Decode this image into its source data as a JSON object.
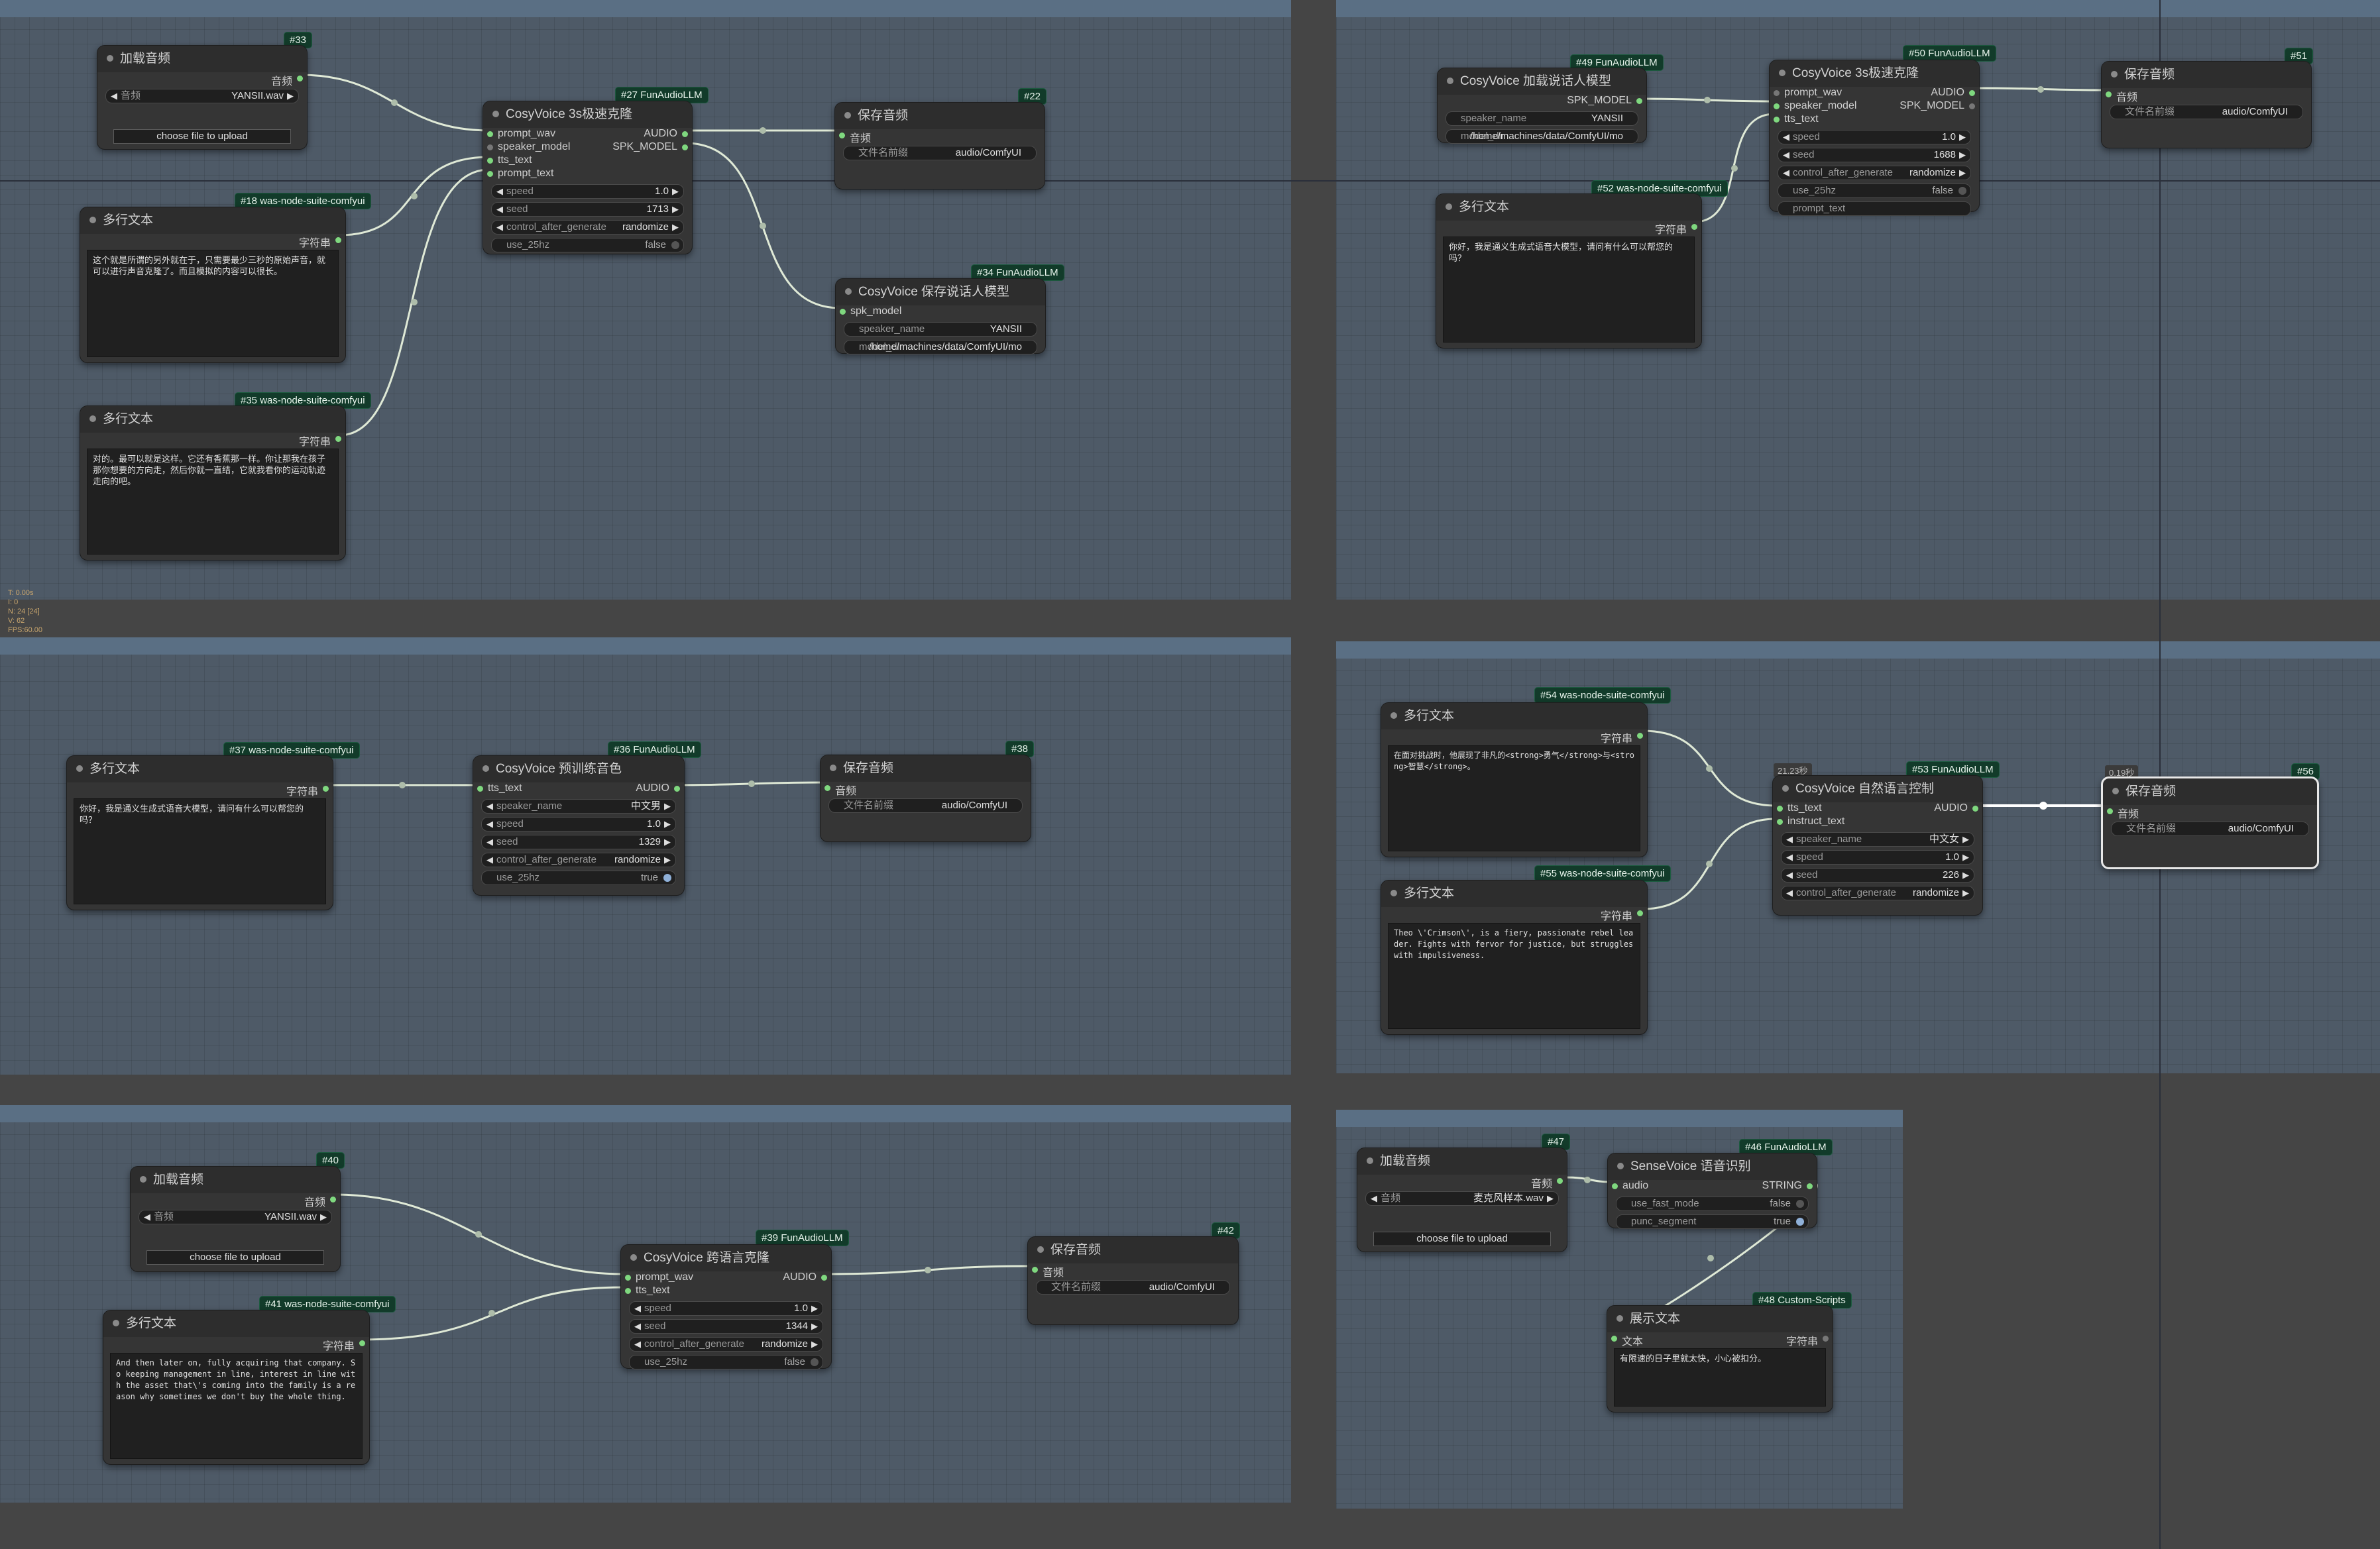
{
  "groups": [
    {
      "id": "g1",
      "title": ""
    },
    {
      "id": "g2",
      "title": ""
    },
    {
      "id": "g3",
      "title": ""
    },
    {
      "id": "g4",
      "title": ""
    },
    {
      "id": "g5",
      "title": ""
    },
    {
      "id": "g6",
      "title": ""
    }
  ],
  "nodes": {
    "n33": {
      "badge": "#33",
      "title": "加载音频",
      "out": "音频",
      "sel_label": "音频",
      "sel_value": "YANSII.wav",
      "upload": "choose file to upload"
    },
    "n18": {
      "badge": "#18 was-node-suite-comfyui",
      "title": "多行文本",
      "out": "字符串",
      "text": "这个就是所谓的另外就在于，只需要最少三秒的原始声音，就可以进行声音克隆了。而且模拟的内容可以很长。"
    },
    "n35": {
      "badge": "#35 was-node-suite-comfyui",
      "title": "多行文本",
      "out": "字符串",
      "text": "对的。最可以就是这样。它还有香蕉那一样。你让那我在孩子那你想要的方向走，然后你就一直结，它就我看你的运动轨迹走向的吧。"
    },
    "n27": {
      "badge": "#27 FunAudioLLM",
      "title": "CosyVoice 3s极速克隆",
      "inputs": [
        "prompt_wav",
        "speaker_model",
        "tts_text",
        "prompt_text"
      ],
      "outputs": [
        "AUDIO",
        "SPK_MODEL"
      ],
      "speed_l": "speed",
      "speed_v": "1.0",
      "seed_l": "seed",
      "seed_v": "1713",
      "cag_l": "control_after_generate",
      "cag_v": "randomize",
      "hz_l": "use_25hz",
      "hz_v": "false"
    },
    "n22": {
      "badge": "#22",
      "title": "保存音频",
      "in": "音频",
      "w_l": "文件名前缀",
      "w_v": "audio/ComfyUI"
    },
    "n34": {
      "badge": "#34 FunAudioLLM",
      "title": "CosyVoice 保存说话人模型",
      "in": "spk_model",
      "sn_l": "speaker_name",
      "sn_v": "YANSII",
      "md_l": "model_dir",
      "md_v": "/home/machines/data/ComfyUI/mo"
    },
    "n49": {
      "badge": "#49 FunAudioLLM",
      "title": "CosyVoice 加载说话人模型",
      "out": "SPK_MODEL",
      "sn_l": "speaker_name",
      "sn_v": "YANSII",
      "md_l": "model_dir",
      "md_v": "/home/machines/data/ComfyUI/mo"
    },
    "n52": {
      "badge": "#52 was-node-suite-comfyui",
      "title": "多行文本",
      "out": "字符串",
      "text": "你好，我是通义生成式语音大模型，请问有什么可以帮您的吗？"
    },
    "n50": {
      "badge": "#50 FunAudioLLM",
      "title": "CosyVoice 3s极速克隆",
      "inputs": [
        "prompt_wav",
        "speaker_model",
        "tts_text"
      ],
      "outputs": [
        "AUDIO",
        "SPK_MODEL"
      ],
      "speed_l": "speed",
      "speed_v": "1.0",
      "seed_l": "seed",
      "seed_v": "1688",
      "cag_l": "control_after_generate",
      "cag_v": "randomize",
      "hz_l": "use_25hz",
      "hz_v": "false",
      "pt_l": "prompt_text"
    },
    "n51": {
      "badge": "#51",
      "title": "保存音频",
      "in": "音频",
      "w_l": "文件名前缀",
      "w_v": "audio/ComfyUI"
    },
    "n37": {
      "badge": "#37 was-node-suite-comfyui",
      "title": "多行文本",
      "out": "字符串",
      "text": "你好，我是通义生成式语音大模型，请问有什么可以帮您的吗？"
    },
    "n36": {
      "badge": "#36 FunAudioLLM",
      "title": "CosyVoice 预训练音色",
      "in": "tts_text",
      "out": "AUDIO",
      "sn_l": "speaker_name",
      "sn_v": "中文男",
      "speed_l": "speed",
      "speed_v": "1.0",
      "seed_l": "seed",
      "seed_v": "1329",
      "cag_l": "control_after_generate",
      "cag_v": "randomize",
      "hz_l": "use_25hz",
      "hz_v": "true"
    },
    "n38": {
      "badge": "#38",
      "title": "保存音频",
      "in": "音频",
      "w_l": "文件名前缀",
      "w_v": "audio/ComfyUI"
    },
    "n54": {
      "badge": "#54 was-node-suite-comfyui",
      "title": "多行文本",
      "out": "字符串",
      "text": "在面对挑战时，他展现了非凡的<strong>勇气</strong>与<strong>智慧</strong>。"
    },
    "n55": {
      "badge": "#55 was-node-suite-comfyui",
      "title": "多行文本",
      "out": "字符串",
      "text": "Theo \\'Crimson\\', is a fiery, passionate rebel leader. Fights with fervor for justice, but struggles with impulsiveness."
    },
    "n53": {
      "badge": "#53 FunAudioLLM",
      "title": "CosyVoice 自然语言控制",
      "timing": "21.23秒",
      "inputs": [
        "tts_text",
        "instruct_text"
      ],
      "out": "AUDIO",
      "sn_l": "speaker_name",
      "sn_v": "中文女",
      "speed_l": "speed",
      "speed_v": "1.0",
      "seed_l": "seed",
      "seed_v": "226",
      "cag_l": "control_after_generate",
      "cag_v": "randomize"
    },
    "n56": {
      "badge": "#56",
      "title": "保存音频",
      "timing": "0.19秒",
      "in": "音频",
      "w_l": "文件名前缀",
      "w_v": "audio/ComfyUI"
    },
    "n40": {
      "badge": "#40",
      "title": "加载音频",
      "out": "音频",
      "sel_label": "音频",
      "sel_value": "YANSII.wav",
      "upload": "choose file to upload"
    },
    "n41": {
      "badge": "#41 was-node-suite-comfyui",
      "title": "多行文本",
      "out": "字符串",
      "text": "And then later on, fully acquiring that company. So keeping management in line, interest in line with the asset that\\'s coming into the family is a reason why sometimes we don't buy the whole thing."
    },
    "n39": {
      "badge": "#39 FunAudioLLM",
      "title": "CosyVoice 跨语言克隆",
      "inputs": [
        "prompt_wav",
        "tts_text"
      ],
      "out": "AUDIO",
      "speed_l": "speed",
      "speed_v": "1.0",
      "seed_l": "seed",
      "seed_v": "1344",
      "cag_l": "control_after_generate",
      "cag_v": "randomize",
      "hz_l": "use_25hz",
      "hz_v": "false"
    },
    "n42": {
      "badge": "#42",
      "title": "保存音频",
      "in": "音频",
      "w_l": "文件名前缀",
      "w_v": "audio/ComfyUI"
    },
    "n47": {
      "badge": "#47",
      "title": "加载音频",
      "out": "音频",
      "sel_label": "音频",
      "sel_value": "麦克风样本.wav",
      "upload": "choose file to upload"
    },
    "n46": {
      "badge": "#46 FunAudioLLM",
      "title": "SenseVoice 语音识别",
      "in": "audio",
      "out": "STRING",
      "fm_l": "use_fast_mode",
      "fm_v": "false",
      "ps_l": "punc_segment",
      "ps_v": "true"
    },
    "n48": {
      "badge": "#48 Custom-Scripts",
      "title": "展示文本",
      "in": "文本",
      "out": "字符串",
      "text": "有限速的日子里就太快，小心被扣分。"
    }
  },
  "stats": [
    "T: 0.00s",
    "I: 0",
    "N: 24 [24]",
    "V: 62",
    "FPS:60.00"
  ],
  "colors": {
    "wire": "#dfe9d6",
    "slot_active": "#7fd87f",
    "badge_bg": "#123b2a",
    "group_bg": "#4e5a67"
  }
}
